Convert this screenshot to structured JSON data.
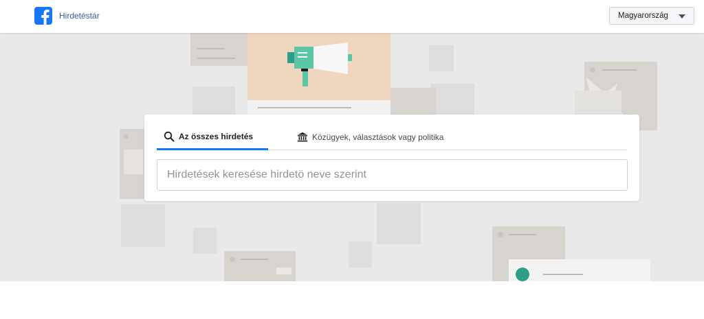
{
  "header": {
    "logo_icon": "facebook-logo-icon",
    "brand_label": "Hirdetéstár",
    "country_select": {
      "selected": "Magyarország",
      "icon": "caret-down-icon"
    }
  },
  "search": {
    "tabs": [
      {
        "label": "Az összes hirdetés",
        "icon": "search-icon",
        "active": true
      },
      {
        "label": "Közügyek, választások vagy politika",
        "icon": "government-building-icon",
        "active": false
      }
    ],
    "input_placeholder": "Hirdetések keresése hirdetö neve szerint",
    "input_value": ""
  },
  "colors": {
    "brand": "#1877f2",
    "hero_background": "#e9e9e9",
    "megaphone_card": "#efd6bf",
    "accent_teal": "#5cc6a7",
    "avatar_green": "#2e9e86"
  }
}
